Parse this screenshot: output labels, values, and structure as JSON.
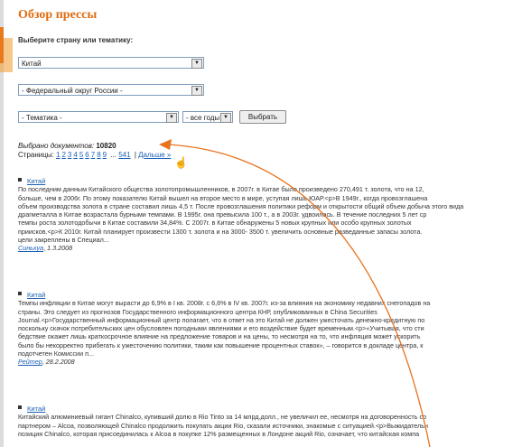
{
  "page": {
    "title": "Обзор прессы",
    "subtitle": "Выберите страну или тематику:"
  },
  "filters": {
    "country": "Китай",
    "district": "- Федеральный округ России -",
    "topic": "- Тематика -",
    "years": "- все годы -",
    "submit_label": "Выбрать"
  },
  "results": {
    "found_label": "Выбрано документов:",
    "found_count": "10820",
    "pages_label": "Страницы:",
    "pages": [
      "1",
      "2",
      "3",
      "4",
      "5",
      "6",
      "7",
      "8",
      "9"
    ],
    "ellipsis": "...",
    "last_page": "541",
    "separator": "|",
    "next_label": "Дальше »"
  },
  "articles": [
    {
      "heading": "Китай",
      "lines": [
        "По последним данным Китайского общества золотопромышленников, в 2007г. в Китае было произведено 270,491 т. золота, что на 12,",
        "больше, чем в 2006г. По этому показателю Китай вышел на второе место в мире, уступая лишь ЮАР.<p>В 1949г., когда провозглашена",
        "объем производства золота в стране составил лишь 4,5 т. После провозглашения политики реформ и открытости общий объем добыча этого вида",
        "драгметалла в Китае возрастала бурными темпами. В 1995г. она превысила 100 т., а в 2003г. удвоилась. В течение последних 5 лет ср",
        "темпы роста золотодобычи в Китае составили 34,84%. С 2007г. в Китае обнаружены 5 новых крупных или особо крупных золотых",
        "приисков.<p>К 2010г. Китай планирует произвести 1300 т. золота и на 3000- 3500 т. увеличить основные разведанные запасы золота.",
        "цели закреплены в Специал..."
      ],
      "source": "Синьхуа",
      "date": "1.3.2008"
    },
    {
      "heading": "Китай",
      "lines": [
        "Темпы инфляции в Китае могут вырасти до 6,9% в I кв. 2008г. с 6,6% в IV кв. 2007г. из-за влияния на экономику недавних снегопадов на",
        "страны. Это следует из прогнозов Государственного информационного центра КНР, опубликованных в China Securities",
        "Journal.<p>Государственный информационный центр полагает, что в ответ на это Китай не должен ужесточать денежно-кредитную по",
        "поскольку скачок потребительских цен обусловлен погодными явлениями и его воздействие будет временным.<p>«Учитывая, что сти",
        "бедствие окажет лишь краткосрочное влияние на предложение товаров и на цены, то несмотря на то, что инфляция может ускорить",
        "было бы некорректно прибегать к ужесточению политики, таким как повышение процентных ставок», – говорится в докладе центра, к",
        "подотчетен Комиссии п..."
      ],
      "source": "Рейтер",
      "date": "28.2.2008"
    },
    {
      "heading": "Китай",
      "lines": [
        "Китайский алюминиевый гигант Chinalco, купивший долю в Rio Tinto за 14 млрд.долл., не увеличил ее, несмотря на договоренность со",
        "партнером – Alcoa, позволяющей Chinalco продолжить покупать акции Rio, сказали источники, знакомые с ситуацией.<p>Выжидательн",
        "позиция Chinalco, которая присоединилась к Alcoa в покупке 12% размещенных в Лондоне акций Rio, означает, что китайская компа"
      ],
      "source": "",
      "date": ""
    }
  ],
  "colors": {
    "title": "#e06c10",
    "link": "#1a5fb4",
    "annotation_arrow": "#e8731e",
    "accent_bar": "#e87a1e"
  }
}
